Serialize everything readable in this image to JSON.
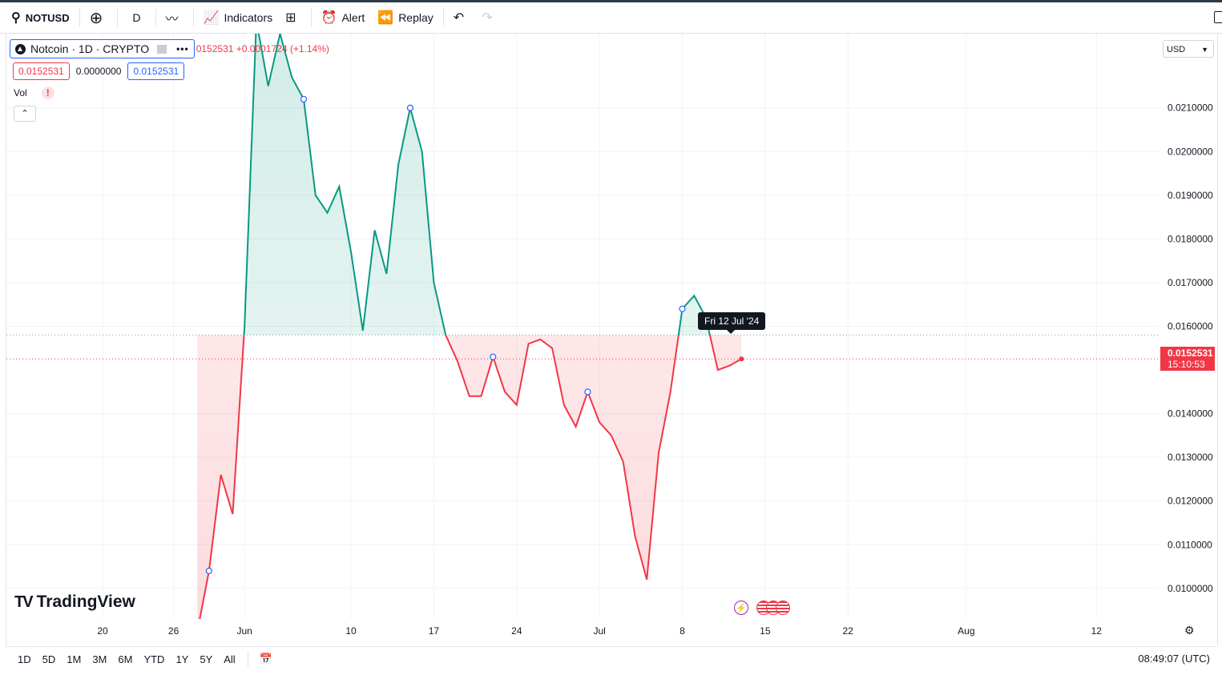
{
  "toolbar": {
    "symbol": "NOTUSD",
    "interval": "D",
    "indicators_label": "Indicators",
    "alert_label": "Alert",
    "replay_label": "Replay"
  },
  "legend": {
    "title": "Notcoin · 1D · CRYPTO",
    "change_text": "0152531 +0.0001724 (+1.14%)",
    "sell_price": "0.0152531",
    "spread": "0.0000000",
    "buy_price": "0.0152531",
    "vol_label": "Vol",
    "warn_symbol": "!"
  },
  "currency": "USD",
  "brand": "TradingView",
  "tooltip": "Fri 12 Jul '24",
  "price_label": {
    "price": "0.0152531",
    "countdown": "15:10:53"
  },
  "bottom": {
    "ranges": [
      "1D",
      "5D",
      "1M",
      "3M",
      "6M",
      "YTD",
      "1Y",
      "5Y",
      "All"
    ],
    "clock": "08:49:07 (UTC)"
  },
  "colors": {
    "up": "#089981",
    "down": "#f23645",
    "accent": "#2962ff",
    "grid": "#f0f3fa"
  },
  "chart_data": {
    "type": "line",
    "subtype": "baseline",
    "baseline": 0.0158,
    "last_price": 0.0152531,
    "ylim": [
      0.0093,
      0.0227
    ],
    "yticks": [
      0.01,
      0.011,
      0.012,
      0.013,
      0.014,
      0.016,
      0.017,
      0.018,
      0.019,
      0.02,
      0.021
    ],
    "ytick_labels": [
      "0.0100000",
      "0.0110000",
      "0.0120000",
      "0.0130000",
      "0.0140000",
      "0.0160000",
      "0.0170000",
      "0.0180000",
      "0.0190000",
      "0.0200000",
      "0.0210000"
    ],
    "xticks": [
      {
        "label": "20",
        "day": 2
      },
      {
        "label": "26",
        "day": 8
      },
      {
        "label": "Jun",
        "day": 14
      },
      {
        "label": "10",
        "day": 23
      },
      {
        "label": "17",
        "day": 30
      },
      {
        "label": "24",
        "day": 37
      },
      {
        "label": "Jul",
        "day": 44
      },
      {
        "label": "8",
        "day": 51
      },
      {
        "label": "15",
        "day": 58
      },
      {
        "label": "22",
        "day": 65
      },
      {
        "label": "Aug",
        "day": 75
      },
      {
        "label": "12",
        "day": 86
      }
    ],
    "x_start": "May 18",
    "series": [
      {
        "values": [
          {
            "day": 10,
            "v": 0.009
          },
          {
            "day": 11,
            "v": 0.0104
          },
          {
            "day": 12,
            "v": 0.0126
          },
          {
            "day": 13,
            "v": 0.0117
          },
          {
            "day": 14,
            "v": 0.016
          },
          {
            "day": 15,
            "v": 0.023
          },
          {
            "day": 16,
            "v": 0.0215
          },
          {
            "day": 17,
            "v": 0.0227
          },
          {
            "day": 18,
            "v": 0.0217
          },
          {
            "day": 19,
            "v": 0.0212
          },
          {
            "day": 20,
            "v": 0.019
          },
          {
            "day": 21,
            "v": 0.0186
          },
          {
            "day": 22,
            "v": 0.0192
          },
          {
            "day": 23,
            "v": 0.0177
          },
          {
            "day": 24,
            "v": 0.0159
          },
          {
            "day": 25,
            "v": 0.0182
          },
          {
            "day": 26,
            "v": 0.0172
          },
          {
            "day": 27,
            "v": 0.0197
          },
          {
            "day": 28,
            "v": 0.021
          },
          {
            "day": 29,
            "v": 0.02
          },
          {
            "day": 30,
            "v": 0.017
          },
          {
            "day": 31,
            "v": 0.0158
          },
          {
            "day": 32,
            "v": 0.0152
          },
          {
            "day": 33,
            "v": 0.0144
          },
          {
            "day": 34,
            "v": 0.0144
          },
          {
            "day": 35,
            "v": 0.0153
          },
          {
            "day": 36,
            "v": 0.0145
          },
          {
            "day": 37,
            "v": 0.0142
          },
          {
            "day": 38,
            "v": 0.0156
          },
          {
            "day": 39,
            "v": 0.0157
          },
          {
            "day": 40,
            "v": 0.0155
          },
          {
            "day": 41,
            "v": 0.0142
          },
          {
            "day": 42,
            "v": 0.0137
          },
          {
            "day": 43,
            "v": 0.0145
          },
          {
            "day": 44,
            "v": 0.0138
          },
          {
            "day": 45,
            "v": 0.0135
          },
          {
            "day": 46,
            "v": 0.0129
          },
          {
            "day": 47,
            "v": 0.0112
          },
          {
            "day": 48,
            "v": 0.0102
          },
          {
            "day": 49,
            "v": 0.0131
          },
          {
            "day": 50,
            "v": 0.0145
          },
          {
            "day": 51,
            "v": 0.0164
          },
          {
            "day": 52,
            "v": 0.0167
          },
          {
            "day": 53,
            "v": 0.0162
          },
          {
            "day": 54,
            "v": 0.015
          },
          {
            "day": 55,
            "v": 0.0151
          },
          {
            "day": 56,
            "v": 0.0152531
          }
        ],
        "markers": [
          11,
          19,
          28,
          35,
          43,
          51
        ]
      }
    ]
  }
}
